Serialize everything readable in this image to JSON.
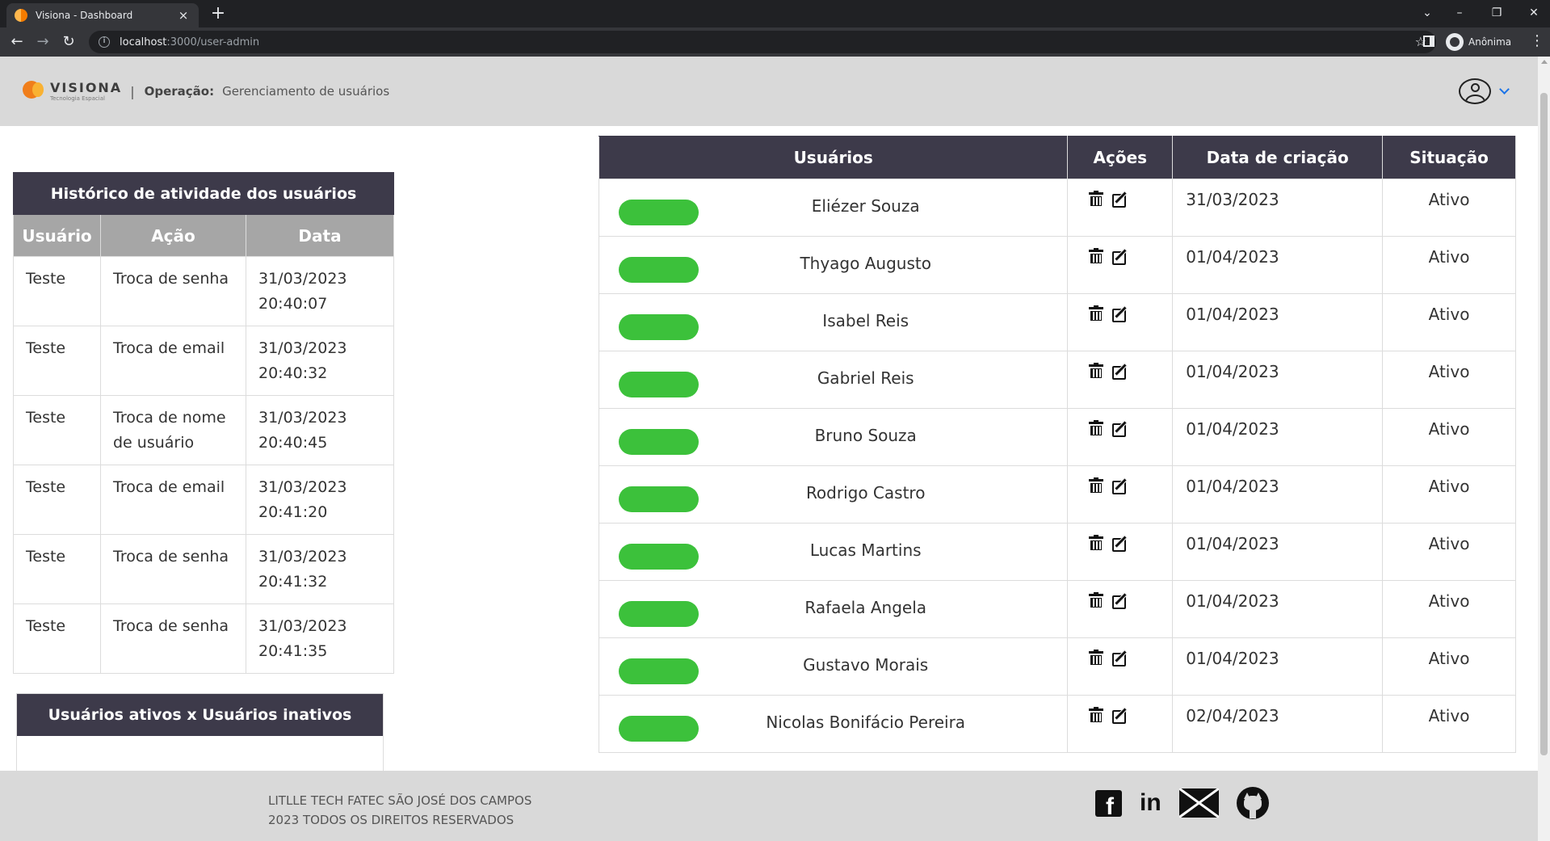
{
  "browser": {
    "tab_title": "Visiona - Dashboard",
    "tab_close": "×",
    "new_tab": "+",
    "url_host": "localhost",
    "url_path": ":3000/user-admin",
    "profile_label": "Anônima"
  },
  "header": {
    "logo_word": "VISIONA",
    "logo_sub": "Tecnologia Espacial",
    "separator": "|",
    "operation_label": "Operação:",
    "operation_value": "Gerenciamento de usuários"
  },
  "history": {
    "title": "Histórico de atividade dos usuários",
    "columns": [
      "Usuário",
      "Ação",
      "Data"
    ],
    "rows": [
      {
        "user": "Teste",
        "action": "Troca de senha",
        "date": "31/03/2023",
        "time": "20:40:07"
      },
      {
        "user": "Teste",
        "action": "Troca de email",
        "date": "31/03/2023",
        "time": "20:40:32"
      },
      {
        "user": "Teste",
        "action": "Troca de nome de usuário",
        "date": "31/03/2023",
        "time": "20:40:45"
      },
      {
        "user": "Teste",
        "action": "Troca de email",
        "date": "31/03/2023",
        "time": "20:41:20"
      },
      {
        "user": "Teste",
        "action": "Troca de senha",
        "date": "31/03/2023",
        "time": "20:41:32"
      },
      {
        "user": "Teste",
        "action": "Troca de senha",
        "date": "31/03/2023",
        "time": "20:41:35"
      }
    ]
  },
  "chart_card": {
    "title": "Usuários ativos x Usuários inativos"
  },
  "users": {
    "columns": [
      "Usuários",
      "Ações",
      "Data de criação",
      "Situação"
    ],
    "status_color": "#3cc13b",
    "rows": [
      {
        "name": "Eliézer Souza",
        "created": "31/03/2023",
        "status": "Ativo"
      },
      {
        "name": "Thyago Augusto",
        "created": "01/04/2023",
        "status": "Ativo"
      },
      {
        "name": "Isabel Reis",
        "created": "01/04/2023",
        "status": "Ativo"
      },
      {
        "name": "Gabriel Reis",
        "created": "01/04/2023",
        "status": "Ativo"
      },
      {
        "name": "Bruno Souza",
        "created": "01/04/2023",
        "status": "Ativo"
      },
      {
        "name": "Rodrigo Castro",
        "created": "01/04/2023",
        "status": "Ativo"
      },
      {
        "name": "Lucas Martins",
        "created": "01/04/2023",
        "status": "Ativo"
      },
      {
        "name": "Rafaela Angela",
        "created": "01/04/2023",
        "status": "Ativo"
      },
      {
        "name": "Gustavo Morais",
        "created": "01/04/2023",
        "status": "Ativo"
      },
      {
        "name": "Nicolas Bonifácio Pereira",
        "created": "02/04/2023",
        "status": "Ativo"
      }
    ]
  },
  "footer": {
    "line1": "LITLLE TECH FATEC SÃO JOSÉ DOS CAMPOS",
    "line2": "2023 TODOS OS DIREITOS RESERVADOS",
    "social": [
      "facebook-icon",
      "linkedin-icon",
      "mail-icon",
      "github-icon"
    ]
  },
  "colors": {
    "header_bg": "#d9d9d9",
    "table_header_bg": "#3d3a4a",
    "history_column_bg": "#a6a6a6",
    "status_green": "#3cc13b"
  }
}
